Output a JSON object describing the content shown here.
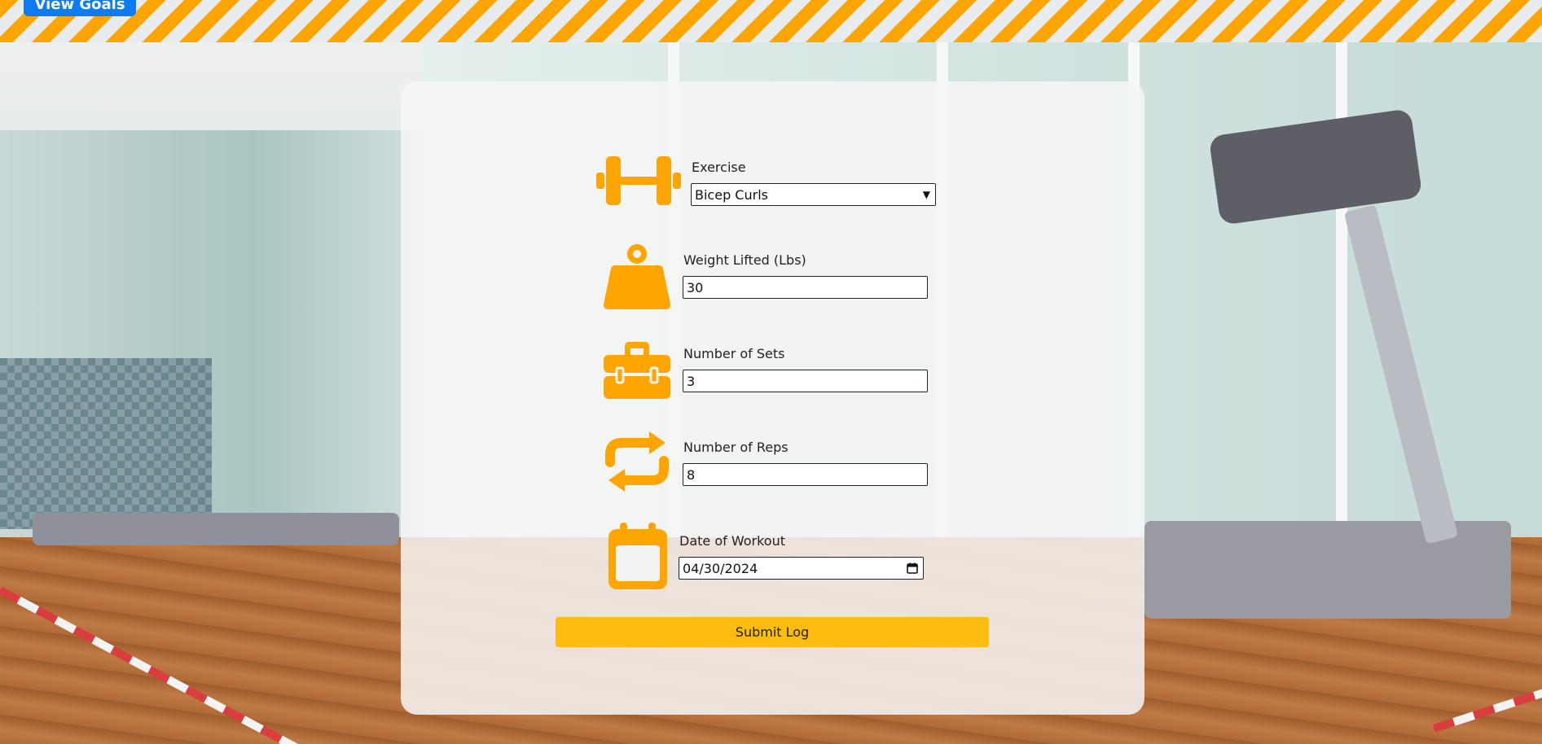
{
  "header": {
    "goals_button_label": "View Goals"
  },
  "form": {
    "exercise": {
      "label": "Exercise",
      "selected": "Bicep Curls",
      "icon": "dumbbell-icon"
    },
    "weight": {
      "label": "Weight Lifted (Lbs)",
      "value": "30",
      "icon": "weight-icon"
    },
    "sets": {
      "label": "Number of Sets",
      "value": "3",
      "icon": "toolbox-icon"
    },
    "reps": {
      "label": "Number of Reps",
      "value": "8",
      "icon": "repeat-icon"
    },
    "date": {
      "label": "Date of Workout",
      "value": "04/30/2024",
      "icon": "calendar-icon"
    },
    "submit_label": "Submit Log"
  },
  "colors": {
    "accent": "#ffa500",
    "submit": "#fdbc0f",
    "goals_button": "#0d7cf2"
  }
}
